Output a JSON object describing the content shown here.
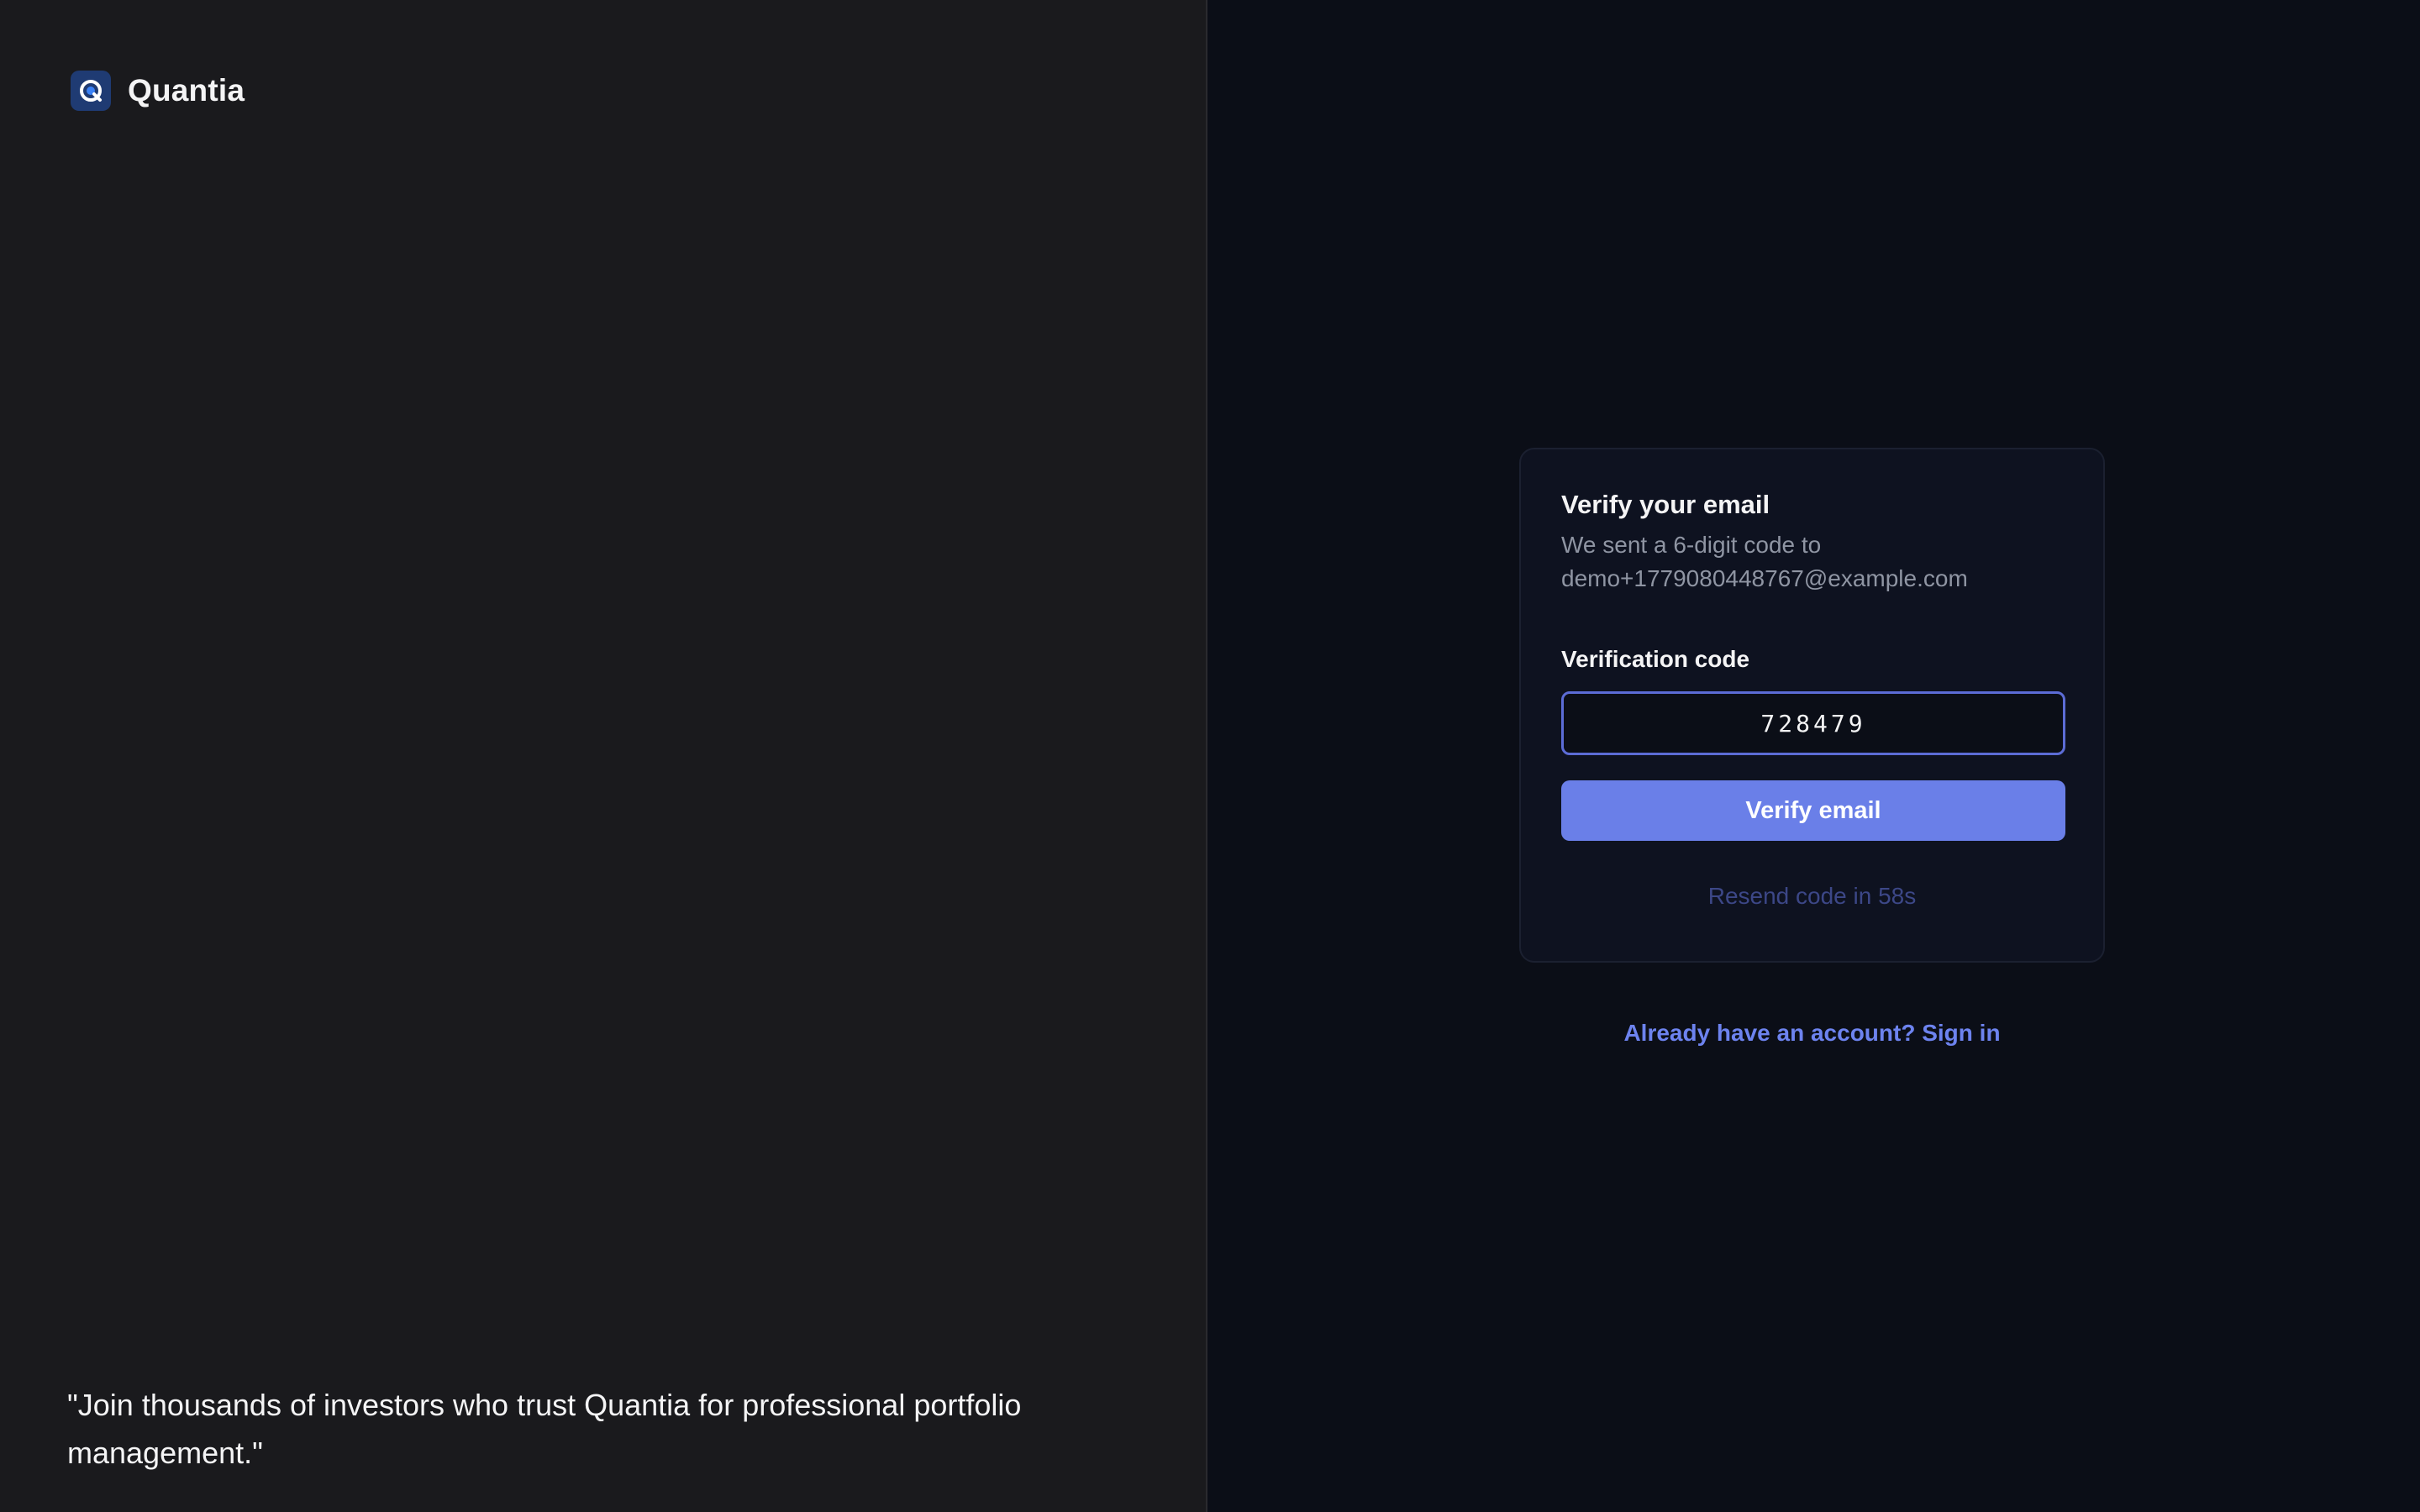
{
  "brand": {
    "name": "Quantia",
    "logo_icon": "q-logo-icon",
    "logo_color": "#1f3b73"
  },
  "hero": {
    "quote": "\"Join thousands of investors who trust Quantia for professional portfolio management.\""
  },
  "verify_card": {
    "title": "Verify your email",
    "subtitle_line1": "We sent a 6-digit code to",
    "email": "demo+1779080448767@example.com",
    "code_label": "Verification code",
    "code_value": "728479",
    "verify_button_label": "Verify email",
    "resend_text": "Resend code in 58s"
  },
  "footer": {
    "signin_link": "Already have an account? Sign in"
  },
  "colors": {
    "accent": "#6a7fe8",
    "left_bg": "#1a1a1d",
    "right_bg": "#0b0e17",
    "link": "#6d83ef",
    "resend_disabled": "#3c4787"
  }
}
